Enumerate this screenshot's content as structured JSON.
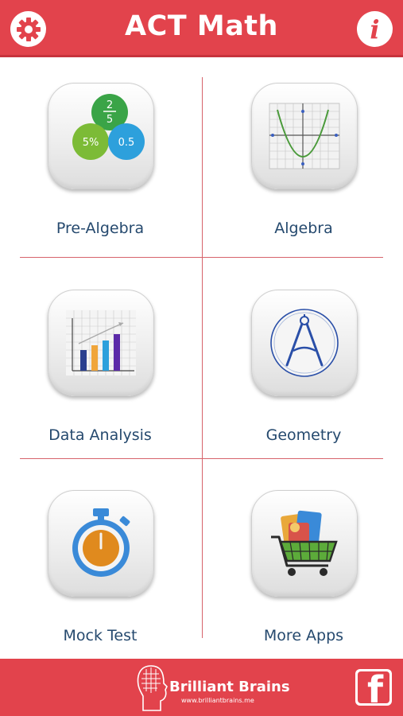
{
  "header": {
    "title": "ACT Math",
    "settings_icon": "gear-icon",
    "info_icon": "info-icon",
    "color": "#e2434c"
  },
  "menu": {
    "tiles": [
      {
        "label": "Pre-Algebra",
        "icon": "fraction-circles-icon",
        "icon_text": {
          "fraction_top": "2",
          "fraction_bottom": "5",
          "percent": "5%",
          "decimal": "0.5"
        }
      },
      {
        "label": "Algebra",
        "icon": "parabola-graph-icon"
      },
      {
        "label": "Data Analysis",
        "icon": "bar-chart-icon"
      },
      {
        "label": "Geometry",
        "icon": "compass-icon"
      },
      {
        "label": "Mock Test",
        "icon": "stopwatch-icon"
      },
      {
        "label": "More Apps",
        "icon": "shopping-cart-icon"
      }
    ]
  },
  "footer": {
    "brand_name": "Brilliant Brains",
    "brand_url": "www.brilliantbrains.me",
    "brand_icon": "brain-head-logo-icon",
    "facebook_icon": "facebook-icon",
    "facebook_glyph": "f"
  }
}
